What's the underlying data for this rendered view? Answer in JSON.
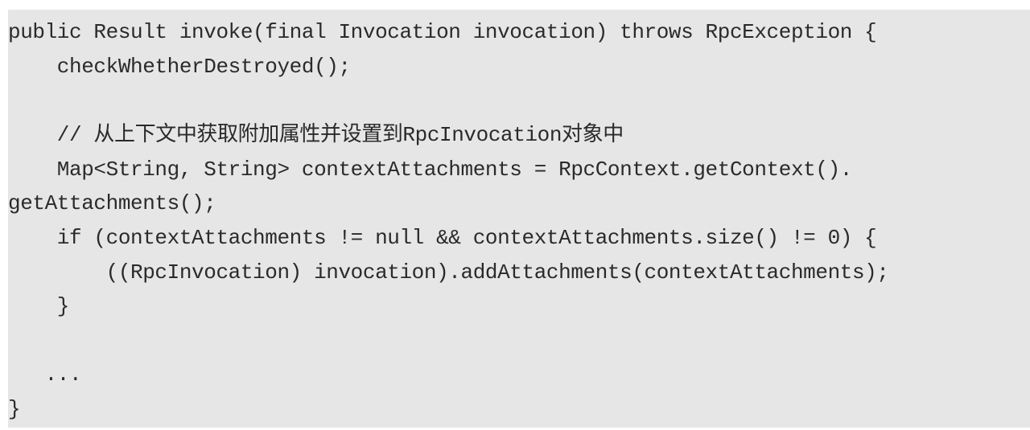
{
  "code": {
    "lines": [
      "public Result invoke(final Invocation invocation) throws RpcException {",
      "    checkWhetherDestroyed();",
      "",
      "    // 从上下文中获取附加属性并设置到RpcInvocation对象中",
      "    Map<String, String> contextAttachments = RpcContext.getContext().",
      "getAttachments();",
      "    if (contextAttachments != null && contextAttachments.size() != 0) {",
      "        ((RpcInvocation) invocation).addAttachments(contextAttachments);",
      "    }",
      "",
      "   ...",
      "}"
    ]
  }
}
